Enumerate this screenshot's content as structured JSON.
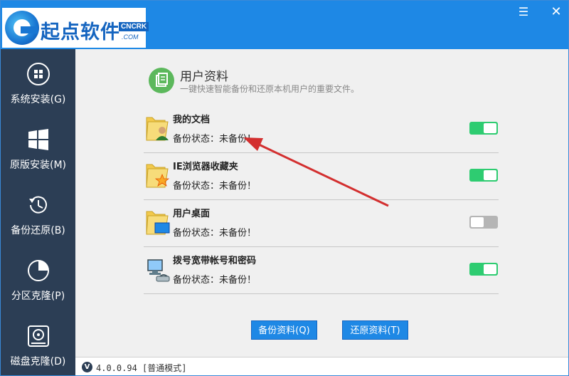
{
  "app": {
    "logo_text": "起点软件",
    "logo_badge": "CNCRK",
    "logo_com": ".COM"
  },
  "window_controls": {
    "menu_icon": "☰",
    "close_icon": "✕"
  },
  "sidebar": {
    "items": [
      {
        "label": "系统安装(G)",
        "icon": "windows-disk-icon"
      },
      {
        "label": "原版安装(M)",
        "icon": "windows-logo-icon"
      },
      {
        "label": "备份还原(B)",
        "icon": "history-icon"
      },
      {
        "label": "分区克隆(P)",
        "icon": "pie-chart-icon"
      },
      {
        "label": "磁盘克隆(D)",
        "icon": "disk-clone-icon"
      }
    ]
  },
  "header": {
    "title": "用户资料",
    "subtitle": "一键快速智能备份和还原本机用户的重要文件。"
  },
  "rows": [
    {
      "name": "我的文档",
      "status": "备份状态：未备份！",
      "enabled": true
    },
    {
      "name": "IE浏览器收藏夹",
      "status": "备份状态：未备份！",
      "enabled": true
    },
    {
      "name": "用户桌面",
      "status": "备份状态：未备份！",
      "enabled": false
    },
    {
      "name": "拨号宽带帐号和密码",
      "status": "备份状态：未备份！",
      "enabled": true
    }
  ],
  "buttons": {
    "backup": "备份资料(Q)",
    "restore": "还原资料(T)"
  },
  "statusbar": {
    "version_icon": "V",
    "version_text": "4.0.0.94 [普通模式]"
  },
  "colors": {
    "titlebar": "#1e88e5",
    "sidebar": "#2c3e55",
    "toggle_on": "#2ecc71",
    "toggle_off": "#b5b5b5",
    "annotation_arrow": "#d32f2f"
  }
}
